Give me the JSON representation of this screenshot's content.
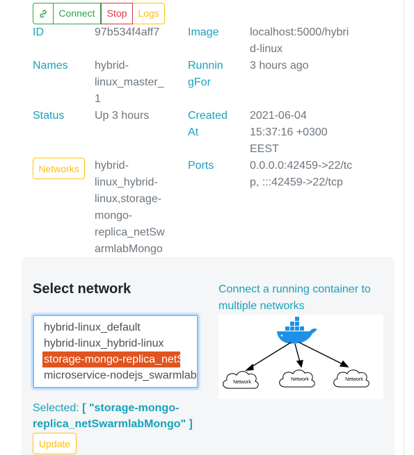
{
  "toolbar": {
    "link_icon": "link-icon",
    "connect_label": "Connect",
    "stop_label": "Stop",
    "logs_label": "Logs"
  },
  "details": {
    "id_label": "ID",
    "id_value": "97b534f4aff7",
    "image_label": "Image",
    "image_value_line1": "localhost:5000/hybri",
    "image_value_line2": "d-linux",
    "names_label": "Names",
    "names_value_line1": "hybrid-",
    "names_value_line2": "linux_master_",
    "names_value_line3": "1",
    "runningfor_label_line1": "Runnin",
    "runningfor_label_line2": "gFor",
    "runningfor_value": "3 hours ago",
    "status_label": "Status",
    "status_value": "Up 3 hours",
    "created_label_line1": "Created",
    "created_label_line2": "At",
    "created_value_line1": "2021-06-04",
    "created_value_line2": "15:37:16 +0300",
    "created_value_line3": "EEST",
    "networks_button": "Networks",
    "networks_value_lines": [
      "hybrid-",
      "linux_hybrid-",
      "linux,storage-",
      "mongo-",
      "replica_netSw",
      "armlabMongo"
    ],
    "ports_label": "Ports",
    "ports_value_line1": "0.0.0.0:42459->22/tc",
    "ports_value_line2": "p, :::42459->22/tcp"
  },
  "select_network": {
    "title": "Select network",
    "options": [
      "hybrid-linux_default",
      "hybrid-linux_hybrid-linux",
      "storage-mongo-replica_netSwarmlabMongo",
      "microservice-nodejs_swarmlab"
    ],
    "selected_index": 2,
    "selected_prefix": "Selected:",
    "selected_value_line1": "[ \"storage-mongo-",
    "selected_value_line2": "replica_netSwarmlabMongo\" ]",
    "update_label": "Update"
  },
  "help": {
    "link_line1": "Connect a running container to",
    "link_line2": "multiple networks",
    "diagram_labels": [
      "Network",
      "Network",
      "Network"
    ]
  },
  "colors": {
    "info": "#17a2b8",
    "success": "#28a745",
    "danger": "#dc3545",
    "warning": "#ffc107",
    "muted": "#6c757d",
    "docker_blue": "#1d91e6",
    "selection": "#e0541f"
  }
}
